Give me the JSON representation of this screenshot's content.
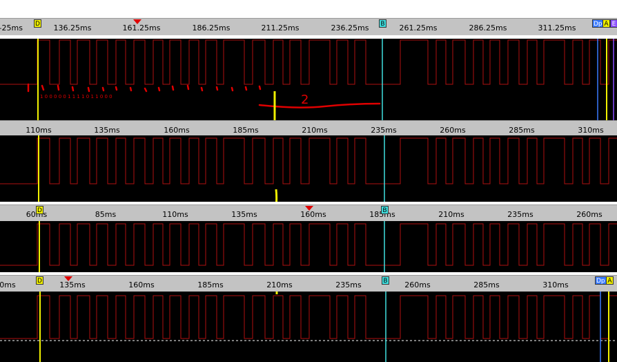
{
  "panels": [
    {
      "ticks": [
        "–25ms",
        "136.25ms",
        "161.25ms",
        "186.25ms",
        "211.25ms",
        "236.25ms",
        "261.25ms",
        "286.25ms",
        "311.25ms"
      ],
      "markers": [
        {
          "label": "D",
          "color": "#f2f200"
        },
        {
          "label": "B",
          "color": "#40e0e0"
        },
        {
          "label": "Dp",
          "color": "#3a7bff"
        },
        {
          "label": "A",
          "color": "#f2f200"
        },
        {
          "label": "E",
          "color": "#8a4dff"
        }
      ],
      "annotations": {
        "bits": "1 0   0   0   0 0   1   1   1   1   0   1   1   0   0   0",
        "number": "2"
      }
    },
    {
      "ticks": [
        "110ms",
        "135ms",
        "160ms",
        "185ms",
        "210ms",
        "235ms",
        "260ms",
        "285ms",
        "310ms"
      ],
      "markers": []
    },
    {
      "ticks": [
        "60ms",
        "85ms",
        "110ms",
        "135ms",
        "160ms",
        "185ms",
        "210ms",
        "235ms",
        "260ms"
      ],
      "markers": [
        {
          "label": "D",
          "color": "#f2f200"
        },
        {
          "label": "B",
          "color": "#40e0e0"
        }
      ]
    },
    {
      "ticks": [
        "0ms",
        "135ms",
        "160ms",
        "185ms",
        "210ms",
        "235ms",
        "260ms",
        "285ms",
        "310ms"
      ],
      "markers": [
        {
          "label": "D",
          "color": "#f2f200"
        },
        {
          "label": "B",
          "color": "#40e0e0"
        },
        {
          "label": "Dp",
          "color": "#3a7bff"
        },
        {
          "label": "A",
          "color": "#f2f200"
        }
      ]
    }
  ],
  "colors": {
    "trace": "#b01010",
    "background": "#000000",
    "ruler": "#c3c3c3",
    "cursor_yellow": "#f2f200",
    "cursor_cyan": "#40e0e0",
    "annotation_red": "#e00000",
    "annotation_yellow": "#f0f000"
  }
}
